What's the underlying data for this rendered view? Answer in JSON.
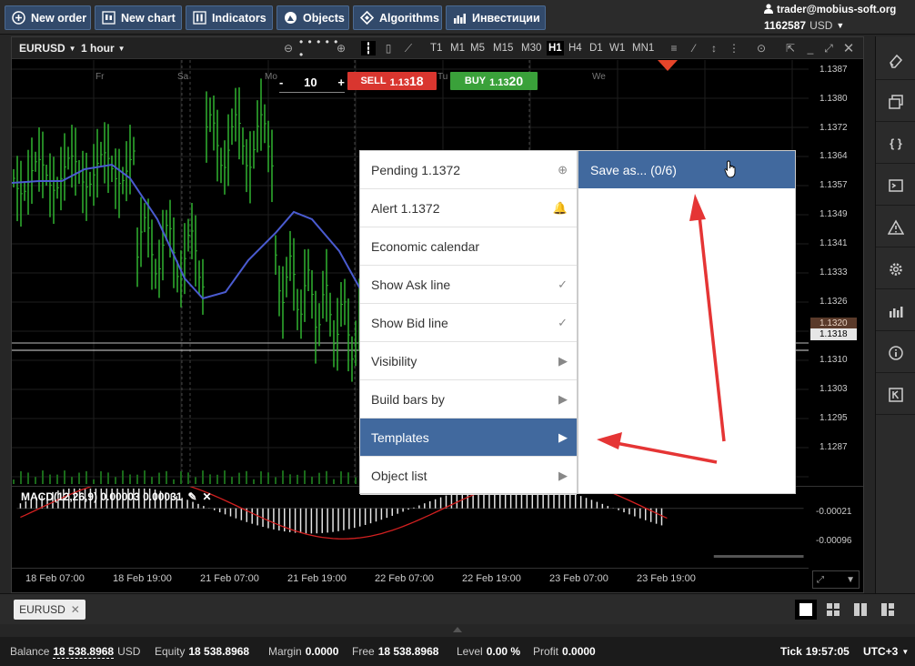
{
  "toolbar": {
    "new_order": "New order",
    "new_chart": "New chart",
    "indicators": "Indicators",
    "objects": "Objects",
    "algorithms": "Algorithms",
    "investments": "Инвестиции"
  },
  "account": {
    "email": "trader@mobius-soft.org",
    "balance": "1162587",
    "currency": "USD"
  },
  "chart": {
    "symbol": "EURUSD",
    "timeframe": "1 hour",
    "timeframes": [
      "T1",
      "M1",
      "M5",
      "M15",
      "M30",
      "H1",
      "H4",
      "D1",
      "W1",
      "MN1"
    ],
    "selected_timeframe": "H1",
    "days": [
      "Fr",
      "Sa",
      "Mo",
      "Tu",
      "We"
    ],
    "y_labels": [
      "1.1387",
      "1.1380",
      "1.1372",
      "1.1364",
      "1.1357",
      "1.1349",
      "1.1341",
      "1.1333",
      "1.1326",
      "1.1320",
      "1.1318",
      "1.1310",
      "1.1303",
      "1.1295",
      "1.1287"
    ],
    "current_price": "1.1318",
    "macd_label": "MACD(12,26,9) 0.00003 0.00031",
    "macd_y_labels": [
      "-0.00021",
      "-0.00096"
    ],
    "x_labels": [
      "18 Feb 07:00",
      "18 Feb 19:00",
      "21 Feb 07:00",
      "21 Feb 19:00",
      "22 Feb 07:00",
      "22 Feb 19:00",
      "23 Feb 07:00",
      "23 Feb 19:00"
    ],
    "colors": {
      "bull": "#2ea82e",
      "ma": "#4a5bd0",
      "macd": "#d22020",
      "histogram": "#e6e6e6"
    }
  },
  "trade": {
    "quantity": "10",
    "minus": "-",
    "plus": "+",
    "sell_label": "SELL",
    "sell_price_small": "1.13",
    "sell_price_big": "18",
    "buy_label": "BUY",
    "buy_price_small": "1.13",
    "buy_price_big": "20"
  },
  "context_menu": {
    "items": [
      {
        "label": "Pending 1.1372",
        "right": "⊕"
      },
      {
        "label": "Alert 1.1372",
        "right": "🔔"
      },
      {
        "label": "Economic calendar",
        "right": ""
      },
      {
        "label": "Show Ask line",
        "right": "✓"
      },
      {
        "label": "Show Bid line",
        "right": "✓"
      },
      {
        "label": "Visibility",
        "right": "▶"
      },
      {
        "label": "Build bars by",
        "right": "▶"
      },
      {
        "label": "Templates",
        "right": "▶"
      },
      {
        "label": "Object list",
        "right": "▶"
      }
    ],
    "submenu_save_as": "Save as... (0/6)"
  },
  "tabs": {
    "eurusd": "EURUSD"
  },
  "status": {
    "balance_label": "Balance",
    "balance_value": "18 538.8968",
    "balance_cur": "USD",
    "equity_label": "Equity",
    "equity_value": "18 538.8968",
    "margin_label": "Margin",
    "margin_value": "0.0000",
    "free_label": "Free",
    "free_value": "18 538.8968",
    "level_label": "Level",
    "level_value": "0.00 %",
    "profit_label": "Profit",
    "profit_value": "0.0000",
    "tick_label": "Tick",
    "tick_value": "19:57:05",
    "tz": "UTC+3"
  }
}
